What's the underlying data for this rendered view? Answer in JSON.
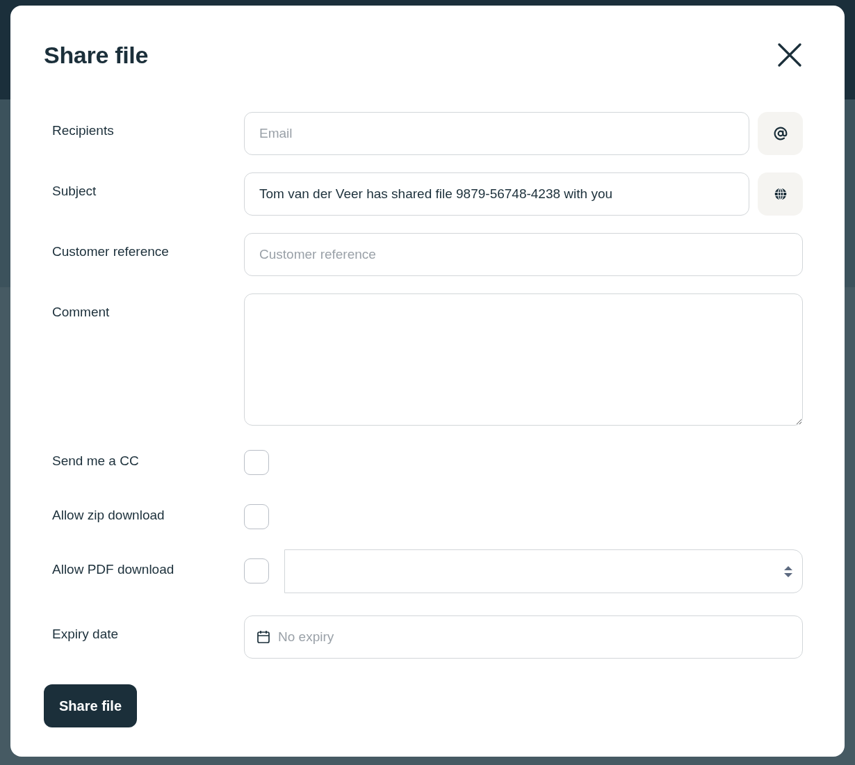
{
  "dialog": {
    "title": "Share file"
  },
  "rows": [
    {
      "kind": "email",
      "label": "Recipients",
      "placeholder": "Email"
    },
    {
      "kind": "localized",
      "label": "Subject",
      "value": "Tom van der Veer has shared file 9879-56748-4238 with you"
    },
    {
      "kind": "input",
      "label": "Customer reference",
      "placeholder": "Customer reference"
    },
    {
      "kind": "textarea",
      "label": "Comment"
    },
    {
      "kind": "checkbox",
      "label": "Send me a CC",
      "checked": false
    },
    {
      "kind": "checkbox",
      "label": "Allow zip download",
      "checked": false
    },
    {
      "kind": "checkbox-select",
      "label": "Allow PDF download",
      "checked": false
    },
    {
      "kind": "date",
      "label": "Expiry date",
      "placeholder": "No expiry"
    }
  ],
  "submit": {
    "label": "Share file"
  }
}
